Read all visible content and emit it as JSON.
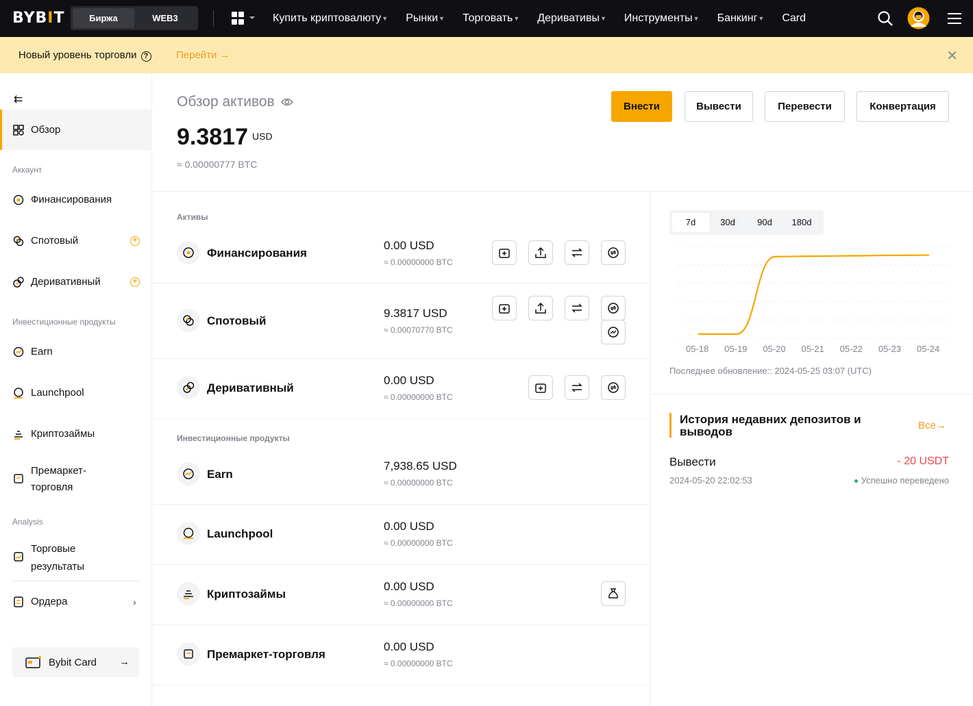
{
  "topbar": {
    "logo": "BYBIT",
    "logo_parts": [
      "BYB",
      "I",
      "T"
    ],
    "segments": [
      "Биржа",
      "WEB3"
    ],
    "nav": [
      "Купить криптовалюту",
      "Рынки",
      "Торговать",
      "Деривативы",
      "Инструменты",
      "Банкинг",
      "Card"
    ],
    "icons": [
      "grid-apps-icon",
      "search-icon",
      "avatar",
      "menu-icon"
    ]
  },
  "banner": {
    "text": "Новый уровень торговли",
    "help": "?",
    "link": "Перейти",
    "close": "✕"
  },
  "sidebar": {
    "collapse": "⇇",
    "overview": "Обзор",
    "group_account": "Аккаунт",
    "funding": "Финансирования",
    "spot": "Спотовый",
    "derivative": "Деривативный",
    "group_invest": "Инвестиционные продукты",
    "earn": "Earn",
    "launchpool": "Launchpool",
    "loans": "Криптозаймы",
    "premarket": "Премаркет-торговля",
    "premarket_l1": "Премаркет-",
    "premarket_l2": "торговля",
    "group_analysis": "Analysis",
    "trading_results_l1": "Торговые",
    "trading_results_l2": "результаты",
    "orders": "Ордера",
    "bybit_card": "Bybit Card"
  },
  "overview": {
    "title": "Обзор активов",
    "balance": "9.3817",
    "currency": "USD",
    "btc_equivalent": "≈ 0.00000777 BTC",
    "buttons": {
      "deposit": "Внести",
      "withdraw": "Вывести",
      "transfer": "Перевести",
      "convert": "Конвертация"
    }
  },
  "assets": {
    "group_account": "Активы",
    "group_invest": "Инвестиционные продукты",
    "rows": [
      {
        "name": "Финансирования",
        "usd": "0.00 USD",
        "btc": "≈ 0.00000000 BTC"
      },
      {
        "name": "Спотовый",
        "usd": "9.3817 USD",
        "btc": "≈ 0.00070770 BTC"
      },
      {
        "name": "Деривативный",
        "usd": "0.00 USD",
        "btc": "≈ 0.00000000 BTC"
      },
      {
        "name": "Earn",
        "usd": "7,938.65 USD",
        "btc": "≈ 0.00000000 BTC"
      },
      {
        "name": "Launchpool",
        "usd": "0.00 USD",
        "btc": "≈ 0.00000000 BTC"
      },
      {
        "name": "Криптозаймы",
        "usd": "0.00 USD",
        "btc": "≈ 0.00000000 BTC"
      },
      {
        "name": "Премаркет-торговля",
        "usd": "0.00 USD",
        "btc": "≈ 0.00000000 BTC"
      }
    ]
  },
  "chart_panel": {
    "ranges": [
      "7d",
      "30d",
      "90d",
      "180d"
    ],
    "selected_range": "7d",
    "last_update": "Последнее обновление:: 2024-05-25 03:07 (UTC)"
  },
  "chart_data": {
    "type": "line",
    "title": "",
    "xlabel": "",
    "ylabel": "",
    "x": [
      "05-18",
      "05-19",
      "05-20",
      "05-21",
      "05-22",
      "05-23",
      "05-24"
    ],
    "series": [
      {
        "values": [
          0.0,
          0.0,
          9.2,
          9.25,
          9.3,
          9.35,
          9.38
        ]
      }
    ],
    "ylim": [
      -0.5,
      10.4
    ],
    "grid": true,
    "color": "#f7a600"
  },
  "history": {
    "title": "История недавних депозитов и выводов",
    "all": "Все",
    "items": [
      {
        "type": "Вывести",
        "amount": "- 20 USDT",
        "date": "2024-05-20 22:02:53",
        "status": "Успешно переведено"
      }
    ]
  },
  "colors": {
    "accent": "#f7a600",
    "negative": "#ef454a",
    "success": "#20b26c"
  }
}
